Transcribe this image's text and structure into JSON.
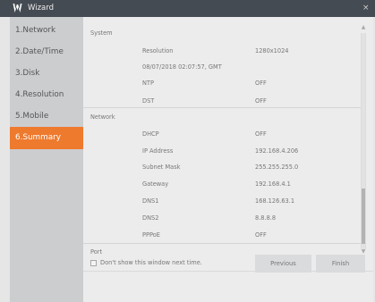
{
  "window": {
    "title": "Wizard",
    "close_glyph": "×",
    "logo_icon": "w-logo-icon",
    "accent_color": "#ee7a2e",
    "titlebar_color": "#454b52"
  },
  "nav": [
    {
      "label": "1.Network",
      "active": false
    },
    {
      "label": "2.Date/Time",
      "active": false
    },
    {
      "label": "3.Disk",
      "active": false
    },
    {
      "label": "4.Resolution",
      "active": false
    },
    {
      "label": "5.Mobile",
      "active": false
    },
    {
      "label": "6.Summary",
      "active": true
    }
  ],
  "system": {
    "header": "System",
    "rows": [
      {
        "label": "Resolution",
        "value": "1280x1024"
      },
      {
        "label": "08/07/2018 02:07:57, GMT",
        "value": ""
      },
      {
        "label": "NTP",
        "value": "OFF"
      },
      {
        "label": "DST",
        "value": "OFF"
      }
    ]
  },
  "network": {
    "header": "Network",
    "rows": [
      {
        "label": "DHCP",
        "value": "OFF"
      },
      {
        "label": "IP Address",
        "value": "192.168.4.206"
      },
      {
        "label": "Subnet Mask",
        "value": "255.255.255.0"
      },
      {
        "label": "Gateway",
        "value": "192.168.4.1"
      },
      {
        "label": "DNS1",
        "value": "168.126.63.1"
      },
      {
        "label": "DNS2",
        "value": "8.8.8.8"
      },
      {
        "label": "PPPoE",
        "value": "OFF"
      }
    ]
  },
  "port": {
    "header": "Port"
  },
  "dont_show": {
    "label": "Don't show this window next time.",
    "checked": false
  },
  "buttons": {
    "previous": "Previous",
    "finish": "Finish"
  },
  "scrollbar": {
    "position": 0.8
  }
}
